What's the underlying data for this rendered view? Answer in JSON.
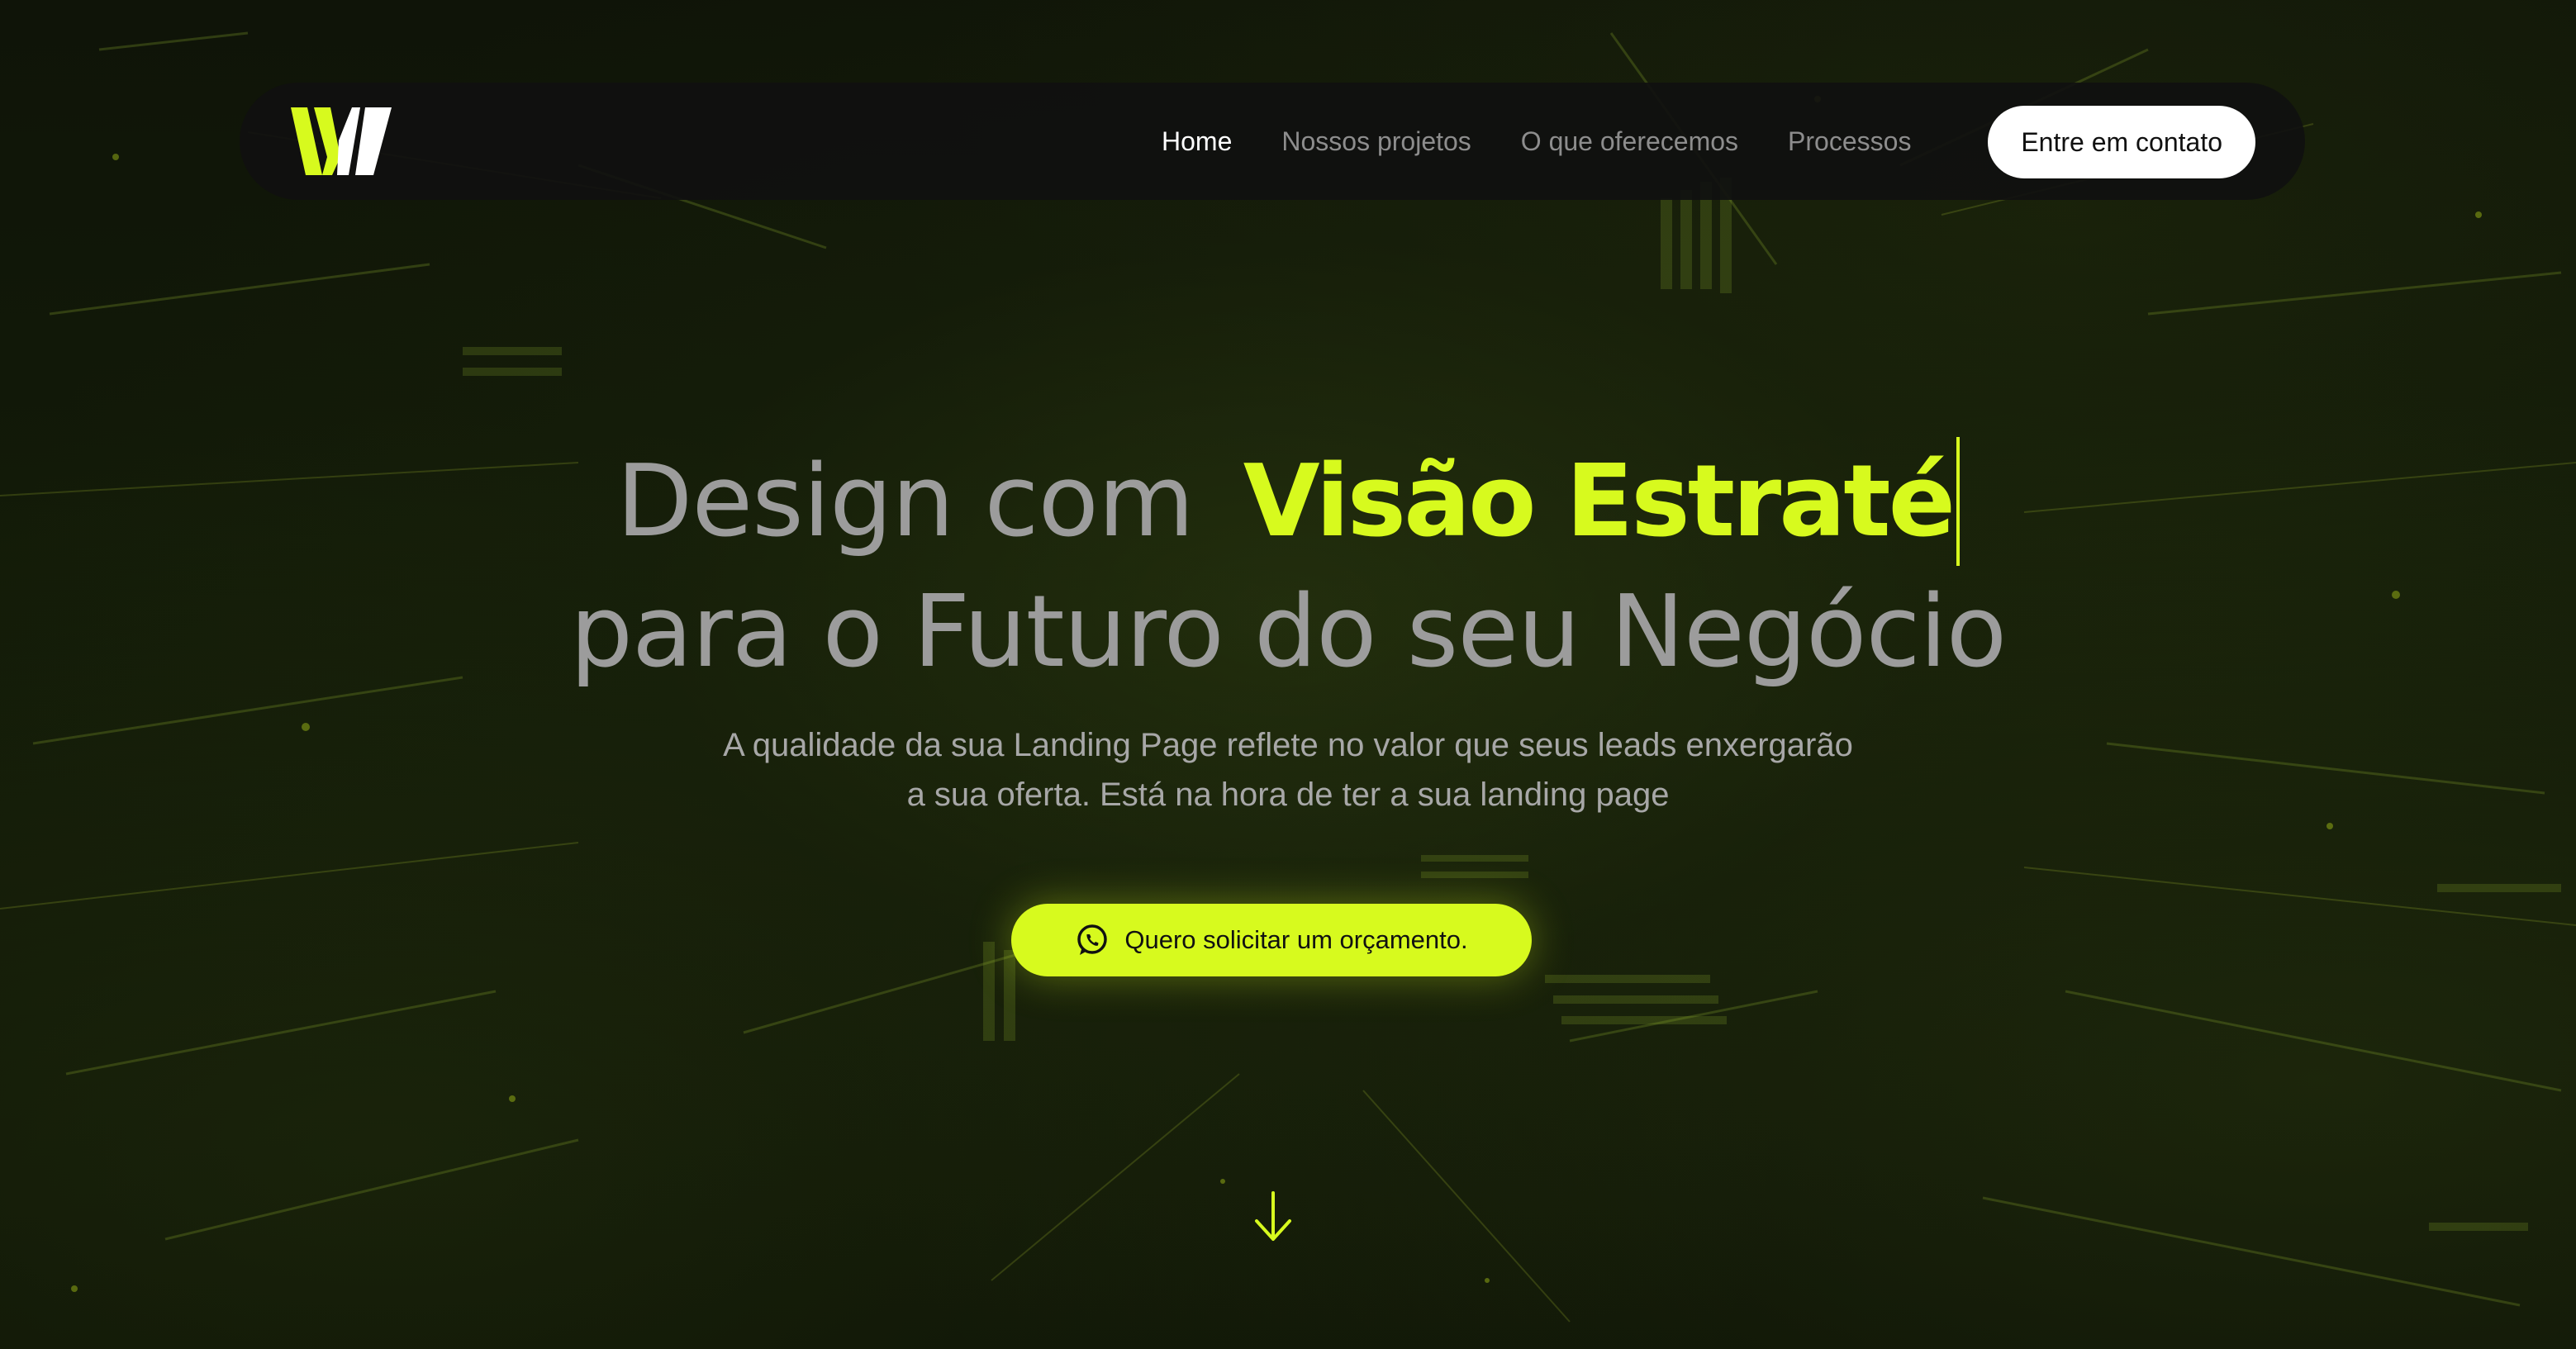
{
  "colors": {
    "accent": "#d7fa1e",
    "background": "#0a0d06",
    "nav_bg": "#101010",
    "text_gray": "#9c9c9c"
  },
  "nav": {
    "logo_icon": "w-logo-icon",
    "links": [
      "Home",
      "Nossos projetos",
      "O que oferecemos",
      "Processos"
    ],
    "active_link": "Home",
    "contact_label": "Entre em contato"
  },
  "hero": {
    "title_prefix": "Design com",
    "title_accent": "Visão Estraté",
    "title_line2": "para o Futuro do seu Negócio",
    "subtitle_line1": "A qualidade da sua Landing Page reflete no valor que seus leads enxergarão",
    "subtitle_line2": "a sua oferta. Está na hora de ter a sua landing page",
    "cta_label": "Quero solicitar um orçamento.",
    "cta_icon": "whatsapp-icon",
    "scroll_icon": "arrow-down-icon"
  }
}
